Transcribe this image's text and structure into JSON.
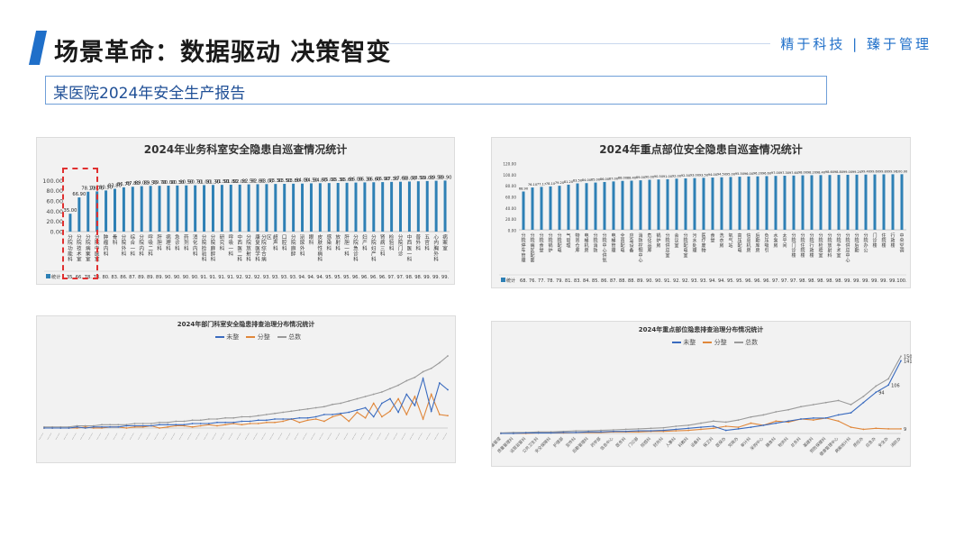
{
  "header": {
    "title": "场景革命：数据驱动 决策智变",
    "tagline": "精于科技 | 臻于管理",
    "subtitle": "某医院2024年安全生产报告"
  },
  "colors": {
    "accent": "#1f6fc9",
    "bar": "#2e80b5",
    "line1": "#3a6bbf",
    "line2": "#e0873a",
    "line3": "#9a9a9a"
  },
  "chart_data": [
    {
      "type": "bar",
      "title": "2024年业务科室安全隐患自巡查情况统计",
      "legend": [
        "统计"
      ],
      "yticks": [
        "100.00",
        "80.00",
        "60.00",
        "40.00",
        "20.00",
        "0.00"
      ],
      "ylim": [
        0,
        120
      ],
      "categories": [
        "分院功能科",
        "分院技术室",
        "分院病案室",
        "分院中医室",
        "肿瘤内科",
        "骨科",
        "分院外科",
        "综合一科",
        "分院内科",
        "呼吸二科",
        "肝胆科",
        "病理科",
        "急诊科",
        "药剂科",
        "消化内科",
        "分院检验科",
        "分院麻醉科",
        "研究科",
        "呼吸一科",
        "中西医二科",
        "分院放射科",
        "康复医学科",
        "分院综合病区",
        "超声科",
        "口腔科",
        "分院麻醉",
        "泌尿外科",
        "眼科",
        "皮肤性病科",
        "感染科",
        "放射科",
        "肝胆一科",
        "分院急诊科",
        "妇产科",
        "分院妇产科",
        "肾病三科",
        "检验科",
        "分院门诊",
        "中西医一科",
        "普外科",
        "五官科",
        "心内胸外科",
        "病案室"
      ],
      "values": [
        35.0,
        66.9,
        78.1,
        78.7,
        80.5,
        83.8,
        86.7,
        87.8,
        89.0,
        89.5,
        89.7,
        90.0,
        90.3,
        90.5,
        90.7,
        91.0,
        91.3,
        91.5,
        91.8,
        92.0,
        92.5,
        92.8,
        93.0,
        93.3,
        93.5,
        93.8,
        94.0,
        94.5,
        94.8,
        95.0,
        95.3,
        95.6,
        96.0,
        96.3,
        96.6,
        96.9,
        97.3,
        97.6,
        98.0,
        98.5,
        99.0,
        99.5,
        99.9
      ],
      "highlight": "分院功能科, 分院技术室, 分院病案室, 分院中医室"
    },
    {
      "type": "bar",
      "title": "2024年重点部位安全隐患自巡查情况统计",
      "legend": [
        "统计"
      ],
      "yticks": [
        "120.00",
        "100.00",
        "80.00",
        "60.00",
        "40.00",
        "20.00",
        "0.00"
      ],
      "ylim": [
        0,
        120
      ],
      "categories": [
        "分院停车管理",
        "分院病区配套",
        "分院食堂",
        "分院锅炉",
        "分院配电",
        "气管理",
        "物资仓库",
        "电梯机房",
        "分院消防",
        "分院中心供氧",
        "电梯管理",
        "全员配电",
        "应急设备",
        "消防控制中心",
        "危化品库",
        "锅炉房",
        "分院供应室",
        "会议室",
        "分院配电室",
        "污水处理",
        "医疗废物",
        "食堂",
        "洗衣房",
        "氧气站",
        "高压配电",
        "信息机房",
        "后勤库房",
        "负压吸引",
        "水泵房",
        "太平间",
        "分院门诊楼",
        "分院住院楼",
        "分院行政楼",
        "分院检验室",
        "分院放射科",
        "分院手术室",
        "分院供应中心",
        "分院后勤",
        "分院办公",
        "门诊楼",
        "住院楼",
        "行政楼",
        "中央空调"
      ],
      "values": [
        68.9,
        76.1,
        77.17,
        78.1,
        79.2,
        81.2,
        83.5,
        84.0,
        85.0,
        86.0,
        87.0,
        88.0,
        88.4,
        89.0,
        90.0,
        90.5,
        91.0,
        92.0,
        92.5,
        93.0,
        93.5,
        94.0,
        94.5,
        95.0,
        95.5,
        96.0,
        96.2,
        96.6,
        97.0,
        97.3,
        97.6,
        98.0,
        98.2,
        98.4,
        98.6,
        98.8,
        99.0,
        99.2,
        99.4,
        99.6,
        99.8,
        99.9,
        100.0
      ]
    },
    {
      "type": "line",
      "title": "2024年部门科室安全隐患排查治理分布情况统计",
      "legend": [
        "未整",
        "分整",
        "总数"
      ],
      "x": 50,
      "series": [
        {
          "name": "未整",
          "values": [
            0,
            0,
            0,
            0,
            1,
            0,
            1,
            1,
            1,
            1,
            2,
            2,
            2,
            2,
            3,
            3,
            3,
            3,
            4,
            4,
            4,
            5,
            5,
            5,
            6,
            6,
            7,
            7,
            8,
            8,
            8,
            9,
            9,
            10,
            12,
            12,
            13,
            14,
            16,
            18,
            10,
            22,
            26,
            14,
            30,
            20,
            44,
            15,
            40,
            34
          ]
        },
        {
          "name": "分整",
          "values": [
            0,
            0,
            0,
            0,
            0,
            1,
            0,
            0,
            1,
            1,
            0,
            1,
            1,
            2,
            0,
            1,
            2,
            2,
            1,
            2,
            3,
            2,
            3,
            4,
            3,
            4,
            4,
            5,
            5,
            6,
            8,
            5,
            7,
            8,
            6,
            10,
            12,
            6,
            14,
            9,
            22,
            10,
            15,
            26,
            12,
            28,
            8,
            30,
            12,
            11
          ]
        },
        {
          "name": "总数",
          "values": [
            1,
            1,
            1,
            1,
            2,
            2,
            2,
            3,
            3,
            3,
            3,
            4,
            4,
            4,
            5,
            5,
            6,
            6,
            7,
            7,
            8,
            8,
            9,
            9,
            10,
            10,
            11,
            12,
            13,
            14,
            15,
            16,
            17,
            18,
            19,
            21,
            22,
            24,
            26,
            28,
            30,
            32,
            35,
            38,
            42,
            45,
            50,
            53,
            58,
            64
          ]
        }
      ]
    },
    {
      "type": "line",
      "title": "2024年重点部位隐患排查治理分布情况统计",
      "legend": [
        "未整",
        "分整",
        "总数"
      ],
      "categories": [
        "工程设备管理",
        "质量管理科",
        "运营监管科",
        "公共卫生科",
        "安全保障科",
        "护理部",
        "宣传科",
        "后勤管理科",
        "药学部",
        "信息中心",
        "医务科",
        "门诊部",
        "院感科",
        "财务科",
        "人事科",
        "科教科",
        "设备科",
        "保卫科",
        "医保办",
        "党政办",
        "审计科",
        "采购中心",
        "膳食科",
        "物资科",
        "总务科",
        "基建科",
        "预防保健科",
        "健康管理中心",
        "病案统计科",
        "质控办",
        "应急办",
        "安全办",
        "消防办"
      ],
      "series": [
        {
          "name": "未整",
          "values": [
            0,
            0,
            1,
            1,
            1,
            2,
            2,
            3,
            3,
            4,
            4,
            5,
            5,
            6,
            8,
            10,
            12,
            14,
            6,
            9,
            12,
            16,
            20,
            24,
            28,
            30,
            30,
            36,
            40,
            60,
            80,
            94,
            141
          ]
        },
        {
          "name": "分整",
          "values": [
            0,
            0,
            0,
            1,
            1,
            1,
            2,
            2,
            2,
            3,
            3,
            3,
            4,
            4,
            5,
            6,
            8,
            10,
            14,
            12,
            20,
            16,
            24,
            22,
            28,
            26,
            30,
            24,
            12,
            8,
            10,
            9,
            9
          ]
        },
        {
          "name": "总数",
          "values": [
            1,
            2,
            2,
            3,
            3,
            4,
            5,
            5,
            6,
            7,
            8,
            9,
            10,
            11,
            14,
            16,
            20,
            24,
            22,
            26,
            32,
            36,
            42,
            46,
            52,
            56,
            60,
            64,
            56,
            72,
            92,
            106,
            150
          ]
        }
      ],
      "labels": [
        "150",
        "141",
        "106",
        "94",
        "9"
      ]
    }
  ]
}
